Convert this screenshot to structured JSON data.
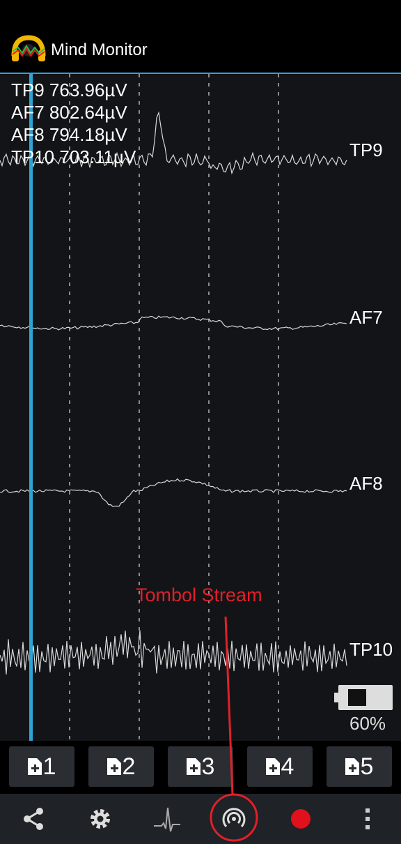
{
  "app": {
    "title": "Mind Monitor"
  },
  "readouts": [
    {
      "channel": "TP9",
      "value": "TP9 763.96µV"
    },
    {
      "channel": "AF7",
      "value": "AF7 802.64µV"
    },
    {
      "channel": "AF8",
      "value": "AF8 794.18µV"
    },
    {
      "channel": "TP10",
      "value": "TP10 703.11µV"
    }
  ],
  "channels": [
    "TP9",
    "AF7",
    "AF8",
    "TP10"
  ],
  "battery": {
    "percent_label": "60%",
    "level": 0.6
  },
  "markers": [
    {
      "label": "1"
    },
    {
      "label": "2"
    },
    {
      "label": "3"
    },
    {
      "label": "4"
    },
    {
      "label": "5"
    }
  ],
  "toolbar": [
    {
      "name": "share-button",
      "icon": "share-icon"
    },
    {
      "name": "settings-button",
      "icon": "gear-icon"
    },
    {
      "name": "waveform-button",
      "icon": "waveform-icon"
    },
    {
      "name": "stream-button",
      "icon": "stream-icon"
    },
    {
      "name": "record-button",
      "icon": "record-icon"
    },
    {
      "name": "more-button",
      "icon": "more-vert-icon"
    }
  ],
  "annotation": {
    "text": "Tombol Stream",
    "color": "#e0202a"
  },
  "colors": {
    "accent": "#2fa3d6",
    "record": "#e0101c",
    "background": "#121417"
  }
}
